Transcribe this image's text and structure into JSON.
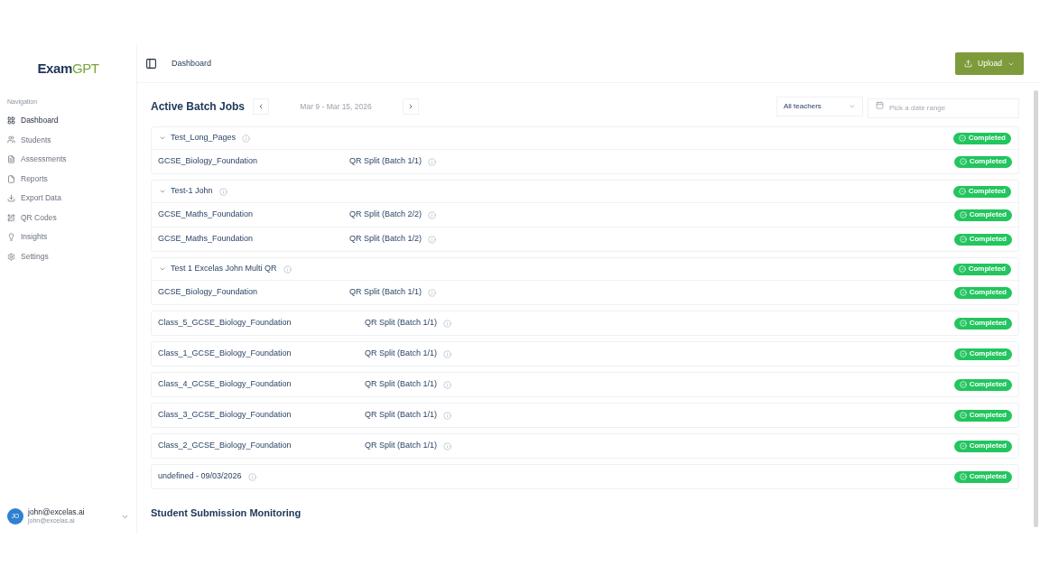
{
  "sidebar": {
    "logo": {
      "primary": "Exam",
      "accent": "GPT"
    },
    "section": "Navigation",
    "items": [
      {
        "label": "Dashboard",
        "selected": true
      },
      {
        "label": "Students",
        "selected": false
      },
      {
        "label": "Assessments",
        "selected": false
      },
      {
        "label": "Reports",
        "selected": false
      },
      {
        "label": "Export Data",
        "selected": false
      },
      {
        "label": "QR Codes",
        "selected": false
      },
      {
        "label": "Insights",
        "selected": false
      },
      {
        "label": "Settings",
        "selected": false
      }
    ],
    "user": {
      "initials": "JO",
      "name": "john@excelas.ai",
      "email": "john@excelas.ai"
    }
  },
  "header": {
    "breadcrumb": "Dashboard",
    "upload_button": "Upload"
  },
  "batch_jobs": {
    "title": "Active Batch Jobs",
    "date_range": "Mar 9 - Mar 15, 2026",
    "teacher_filter": "All teachers",
    "date_picker": {
      "placeholder": "Pick a date range"
    },
    "cards": [
      {
        "kind": "group",
        "name": "Test_Long_Pages",
        "expanded": true,
        "status": "Completed",
        "jobs": [
          {
            "name": "GCSE_Biology_Foundation",
            "type": "QR Split (Batch 1/1)",
            "status": "Completed"
          }
        ]
      },
      {
        "kind": "group",
        "name": "Test-1 John",
        "expanded": true,
        "status": "Completed",
        "jobs": [
          {
            "name": "GCSE_Maths_Foundation",
            "type": "QR Split (Batch 2/2)",
            "status": "Completed"
          },
          {
            "name": "GCSE_Maths_Foundation",
            "type": "QR Split (Batch 1/2)",
            "status": "Completed"
          }
        ]
      },
      {
        "kind": "group",
        "name": "Test 1 Excelas John Multi QR",
        "expanded": true,
        "status": "Completed",
        "jobs": [
          {
            "name": "GCSE_Biology_Foundation",
            "type": "QR Split (Batch 1/1)",
            "status": "Completed"
          }
        ]
      },
      {
        "kind": "single",
        "name": "Class_5_GCSE_Biology_Foundation",
        "type": "QR Split (Batch 1/1)",
        "status": "Completed"
      },
      {
        "kind": "single",
        "name": "Class_1_GCSE_Biology_Foundation",
        "type": "QR Split (Batch 1/1)",
        "status": "Completed"
      },
      {
        "kind": "single",
        "name": "Class_4_GCSE_Biology_Foundation",
        "type": "QR Split (Batch 1/1)",
        "status": "Completed"
      },
      {
        "kind": "single",
        "name": "Class_3_GCSE_Biology_Foundation",
        "type": "QR Split (Batch 1/1)",
        "status": "Completed"
      },
      {
        "kind": "single",
        "name": "Class_2_GCSE_Biology_Foundation",
        "type": "QR Split (Batch 1/1)",
        "status": "Completed"
      },
      {
        "kind": "single",
        "name": "undefined - 09/03/2026",
        "status": "Completed"
      }
    ]
  },
  "submissions": {
    "title": "Student Submission Monitoring"
  }
}
